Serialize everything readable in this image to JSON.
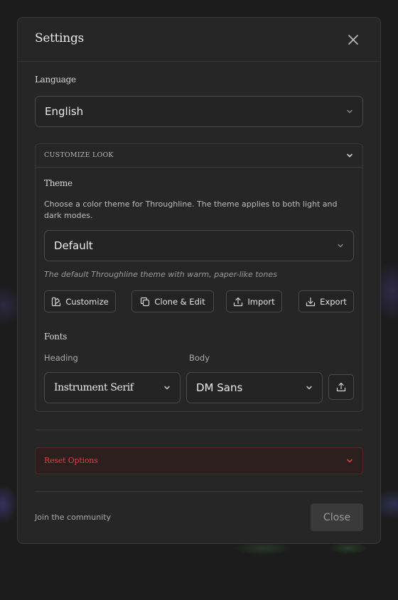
{
  "dialog": {
    "title": "Settings"
  },
  "language": {
    "label": "Language",
    "selected": "English"
  },
  "customize": {
    "header": "CUSTOMIZE LOOK",
    "theme_label": "Theme",
    "theme_description": "Choose a color theme for Throughline. The theme applies to both light and dark modes.",
    "theme_selected": "Default",
    "theme_hint": "The default Throughline theme with warm, paper-like tones",
    "buttons": {
      "customize": "Customize",
      "clone_edit": "Clone & Edit",
      "import": "Import",
      "export": "Export"
    },
    "fonts_label": "Fonts",
    "heading_label": "Heading",
    "heading_selected": "Instrument Serif",
    "body_label": "Body",
    "body_selected": "DM Sans"
  },
  "reset": {
    "label": "Reset Options",
    "accent": "#d24444"
  },
  "footer": {
    "community_link": "Join the community",
    "close_label": "Close"
  },
  "icons": {
    "close": "close-icon",
    "chevron": "chevron-down-icon",
    "customize": "palette-icon",
    "clone": "copy-icon",
    "import": "upload-icon",
    "export": "download-icon",
    "font_upload": "upload-icon"
  }
}
